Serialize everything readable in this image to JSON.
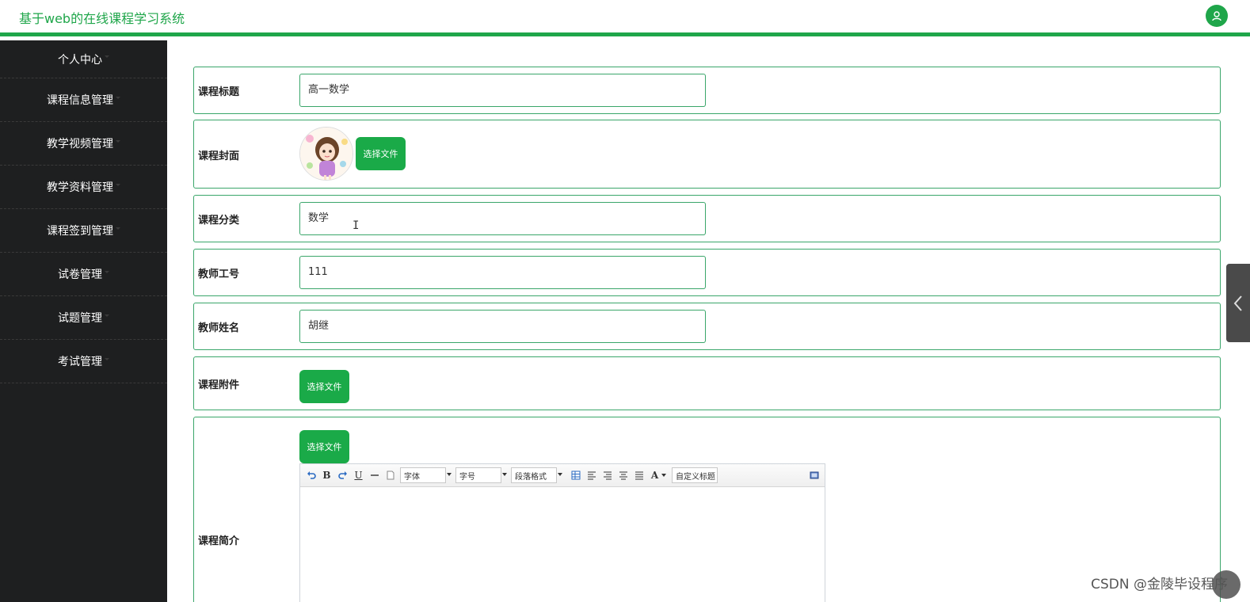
{
  "header": {
    "title": "基于web的在线课程学习系统",
    "avatar_icon": "user-icon"
  },
  "sidebar": {
    "items": [
      {
        "label": "个人中心"
      },
      {
        "label": "课程信息管理"
      },
      {
        "label": "教学视频管理"
      },
      {
        "label": "教学资料管理"
      },
      {
        "label": "课程签到管理"
      },
      {
        "label": "试卷管理"
      },
      {
        "label": "试题管理"
      },
      {
        "label": "考试管理"
      }
    ]
  },
  "form": {
    "title": {
      "label": "课程标题",
      "value": "高一数学"
    },
    "cover": {
      "label": "课程封面",
      "button": "选择文件"
    },
    "category": {
      "label": "课程分类",
      "value": "数学"
    },
    "teacher_id": {
      "label": "教师工号",
      "value": "111"
    },
    "teacher_name": {
      "label": "教师姓名",
      "value": "胡继"
    },
    "attachment": {
      "label": "课程附件",
      "button": "选择文件"
    },
    "intro": {
      "label": "课程简介",
      "button": "选择文件",
      "toolbar": {
        "font": "字体",
        "size": "字号",
        "paragraph": "段落格式",
        "custom_title": "自定义标题",
        "bold": "B",
        "underline": "U",
        "font_color": "A"
      }
    }
  },
  "watermark": "CSDN @金陵毕设程序",
  "colors": {
    "accent": "#1fa64a",
    "sidebar_bg": "#1e1f20",
    "button": "#1aaa48",
    "border": "#3aa66a"
  }
}
